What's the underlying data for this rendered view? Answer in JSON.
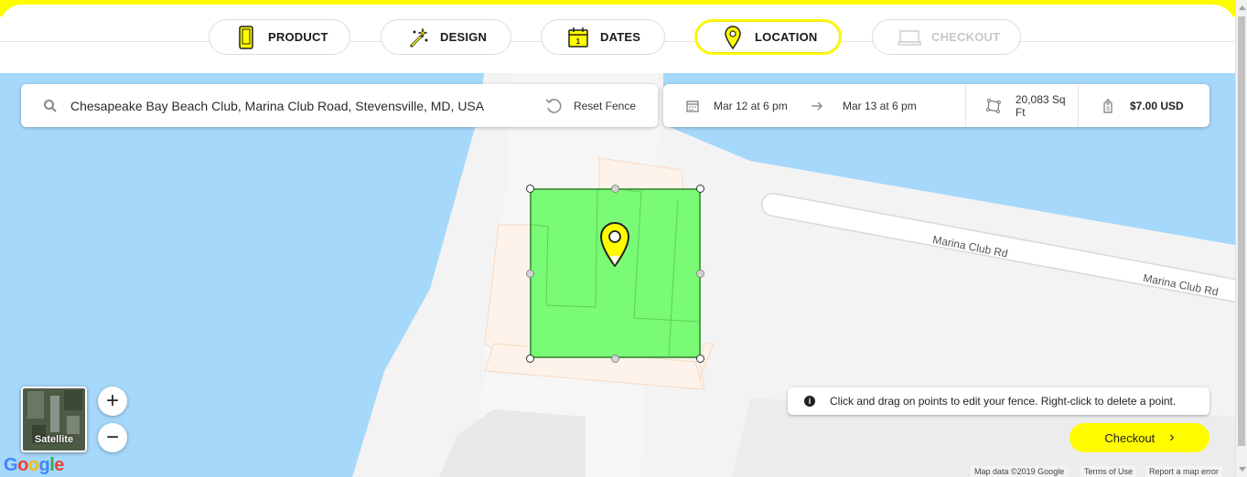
{
  "steps": [
    {
      "label": "PRODUCT",
      "icon": "phone-icon"
    },
    {
      "label": "DESIGN",
      "icon": "magic-wand-icon"
    },
    {
      "label": "DATES",
      "icon": "calendar-icon"
    },
    {
      "label": "LOCATION",
      "icon": "map-pin-icon"
    },
    {
      "label": "CHECKOUT",
      "icon": "laptop-icon"
    }
  ],
  "search": {
    "value": "Chesapeake Bay Beach Club, Marina Club Road, Stevensville, MD, USA"
  },
  "reset_label": "Reset Fence",
  "summary": {
    "start": "Mar 12 at 6 pm",
    "end": "Mar 13 at 6 pm",
    "area": "20,083 Sq Ft",
    "price": "$7.00 USD"
  },
  "map": {
    "road_label_1": "Marina Club Rd",
    "road_label_2": "Marina Club Rd",
    "satellite_label": "Satellite",
    "zoom_in": "+",
    "zoom_out": "−",
    "hint": "Click and drag on points to edit your fence. Right-click to delete a point.",
    "hint_icon": "i",
    "attribution": "Map data ©2019 Google",
    "terms": "Terms of Use",
    "report": "Report a map error",
    "logo": "Google"
  },
  "checkout_button": "Checkout",
  "colors": {
    "brand_yellow": "#fffc00",
    "water": "#a6d8fb",
    "fence_fill": "#79fb75",
    "fence_stroke": "#4f9e4b"
  }
}
